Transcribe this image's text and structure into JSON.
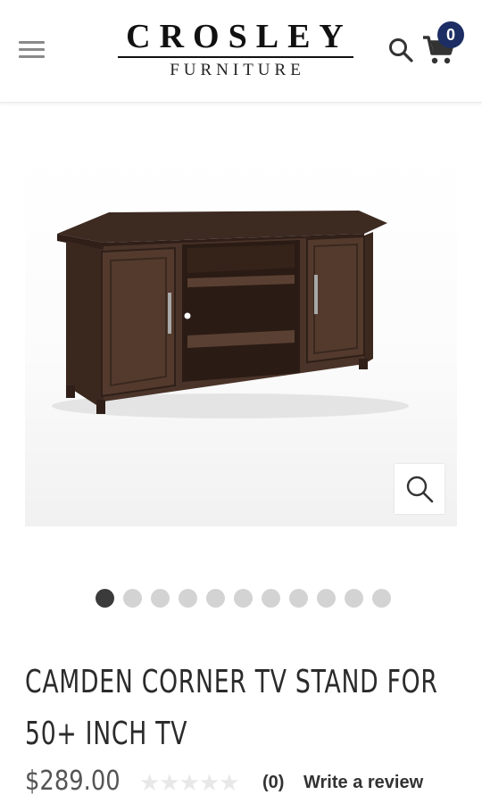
{
  "header": {
    "brand": "CROSLEY",
    "sub_brand": "FURNITURE",
    "cart_count": "0"
  },
  "product": {
    "title_line1": "CAMDEN CORNER TV STAND FOR",
    "title_line2": "50+ INCH TV",
    "price": "$289.00",
    "rating": 0,
    "stars": "★★★★★",
    "review_count": "(0)",
    "write_review_label": "Write a review",
    "image_count": 11,
    "active_image": 1
  },
  "colors": {
    "badge": "#1c2e63",
    "wood": "#4a3328",
    "dot_active": "#3b3b3b",
    "dot_inactive": "#d3d3d3"
  },
  "icons": [
    "menu-icon",
    "search-icon",
    "cart-icon",
    "zoom-icon"
  ]
}
